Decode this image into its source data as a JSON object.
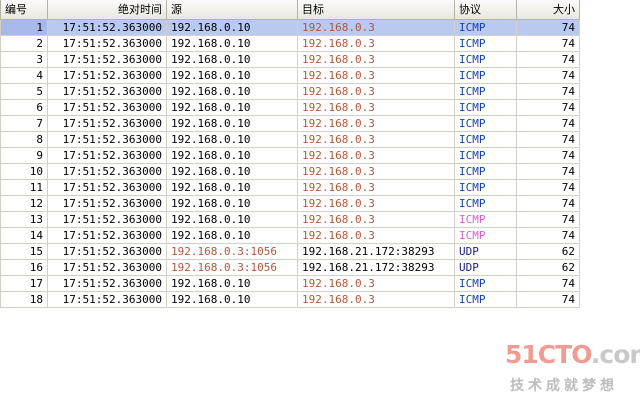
{
  "columns": {
    "no": "编号",
    "time": "绝对时间",
    "src": "源",
    "dst": "目标",
    "proto": "协议",
    "size": "大小"
  },
  "colors": {
    "selected_row": "#b9c9ef",
    "header": "#ecebe5",
    "ip_brown": "#b0583c",
    "icmp_blue": "#1b3fae",
    "icmp_pink": "#d760d6",
    "udp_navy": "#1a237e"
  },
  "selected_row": 1,
  "rows": [
    {
      "no": "1",
      "time": "17:51:52.363000",
      "src": "192.168.0.10",
      "dst": "192.168.0.3",
      "proto": "ICMP",
      "size": "74",
      "src_style": "black",
      "dst_style": "brown",
      "proto_style": "blue"
    },
    {
      "no": "2",
      "time": "17:51:52.363000",
      "src": "192.168.0.10",
      "dst": "192.168.0.3",
      "proto": "ICMP",
      "size": "74",
      "src_style": "black",
      "dst_style": "brown",
      "proto_style": "blue"
    },
    {
      "no": "3",
      "time": "17:51:52.363000",
      "src": "192.168.0.10",
      "dst": "192.168.0.3",
      "proto": "ICMP",
      "size": "74",
      "src_style": "black",
      "dst_style": "brown",
      "proto_style": "blue"
    },
    {
      "no": "4",
      "time": "17:51:52.363000",
      "src": "192.168.0.10",
      "dst": "192.168.0.3",
      "proto": "ICMP",
      "size": "74",
      "src_style": "black",
      "dst_style": "brown",
      "proto_style": "blue"
    },
    {
      "no": "5",
      "time": "17:51:52.363000",
      "src": "192.168.0.10",
      "dst": "192.168.0.3",
      "proto": "ICMP",
      "size": "74",
      "src_style": "black",
      "dst_style": "brown",
      "proto_style": "blue"
    },
    {
      "no": "6",
      "time": "17:51:52.363000",
      "src": "192.168.0.10",
      "dst": "192.168.0.3",
      "proto": "ICMP",
      "size": "74",
      "src_style": "black",
      "dst_style": "brown",
      "proto_style": "blue"
    },
    {
      "no": "7",
      "time": "17:51:52.363000",
      "src": "192.168.0.10",
      "dst": "192.168.0.3",
      "proto": "ICMP",
      "size": "74",
      "src_style": "black",
      "dst_style": "brown",
      "proto_style": "blue"
    },
    {
      "no": "8",
      "time": "17:51:52.363000",
      "src": "192.168.0.10",
      "dst": "192.168.0.3",
      "proto": "ICMP",
      "size": "74",
      "src_style": "black",
      "dst_style": "brown",
      "proto_style": "blue"
    },
    {
      "no": "9",
      "time": "17:51:52.363000",
      "src": "192.168.0.10",
      "dst": "192.168.0.3",
      "proto": "ICMP",
      "size": "74",
      "src_style": "black",
      "dst_style": "brown",
      "proto_style": "blue"
    },
    {
      "no": "10",
      "time": "17:51:52.363000",
      "src": "192.168.0.10",
      "dst": "192.168.0.3",
      "proto": "ICMP",
      "size": "74",
      "src_style": "black",
      "dst_style": "brown",
      "proto_style": "blue"
    },
    {
      "no": "11",
      "time": "17:51:52.363000",
      "src": "192.168.0.10",
      "dst": "192.168.0.3",
      "proto": "ICMP",
      "size": "74",
      "src_style": "black",
      "dst_style": "brown",
      "proto_style": "blue"
    },
    {
      "no": "12",
      "time": "17:51:52.363000",
      "src": "192.168.0.10",
      "dst": "192.168.0.3",
      "proto": "ICMP",
      "size": "74",
      "src_style": "black",
      "dst_style": "brown",
      "proto_style": "blue"
    },
    {
      "no": "13",
      "time": "17:51:52.363000",
      "src": "192.168.0.10",
      "dst": "192.168.0.3",
      "proto": "ICMP",
      "size": "74",
      "src_style": "black",
      "dst_style": "brown",
      "proto_style": "pink"
    },
    {
      "no": "14",
      "time": "17:51:52.363000",
      "src": "192.168.0.10",
      "dst": "192.168.0.3",
      "proto": "ICMP",
      "size": "74",
      "src_style": "black",
      "dst_style": "brown",
      "proto_style": "pink"
    },
    {
      "no": "15",
      "time": "17:51:52.363000",
      "src": "192.168.0.3:1056",
      "dst": "192.168.21.172:38293",
      "proto": "UDP",
      "size": "62",
      "src_style": "brown",
      "dst_style": "black",
      "proto_style": "navy"
    },
    {
      "no": "16",
      "time": "17:51:52.363000",
      "src": "192.168.0.3:1056",
      "dst": "192.168.21.172:38293",
      "proto": "UDP",
      "size": "62",
      "src_style": "brown",
      "dst_style": "black",
      "proto_style": "navy"
    },
    {
      "no": "17",
      "time": "17:51:52.363000",
      "src": "192.168.0.10",
      "dst": "192.168.0.3",
      "proto": "ICMP",
      "size": "74",
      "src_style": "black",
      "dst_style": "brown",
      "proto_style": "blue"
    },
    {
      "no": "18",
      "time": "17:51:52.363000",
      "src": "192.168.0.10",
      "dst": "192.168.0.3",
      "proto": "ICMP",
      "size": "74",
      "src_style": "black",
      "dst_style": "brown",
      "proto_style": "blue"
    }
  ],
  "watermark": {
    "brand_prefix": "51CTO",
    "brand_suffix": ".com",
    "slogan": "技术成就梦想"
  }
}
